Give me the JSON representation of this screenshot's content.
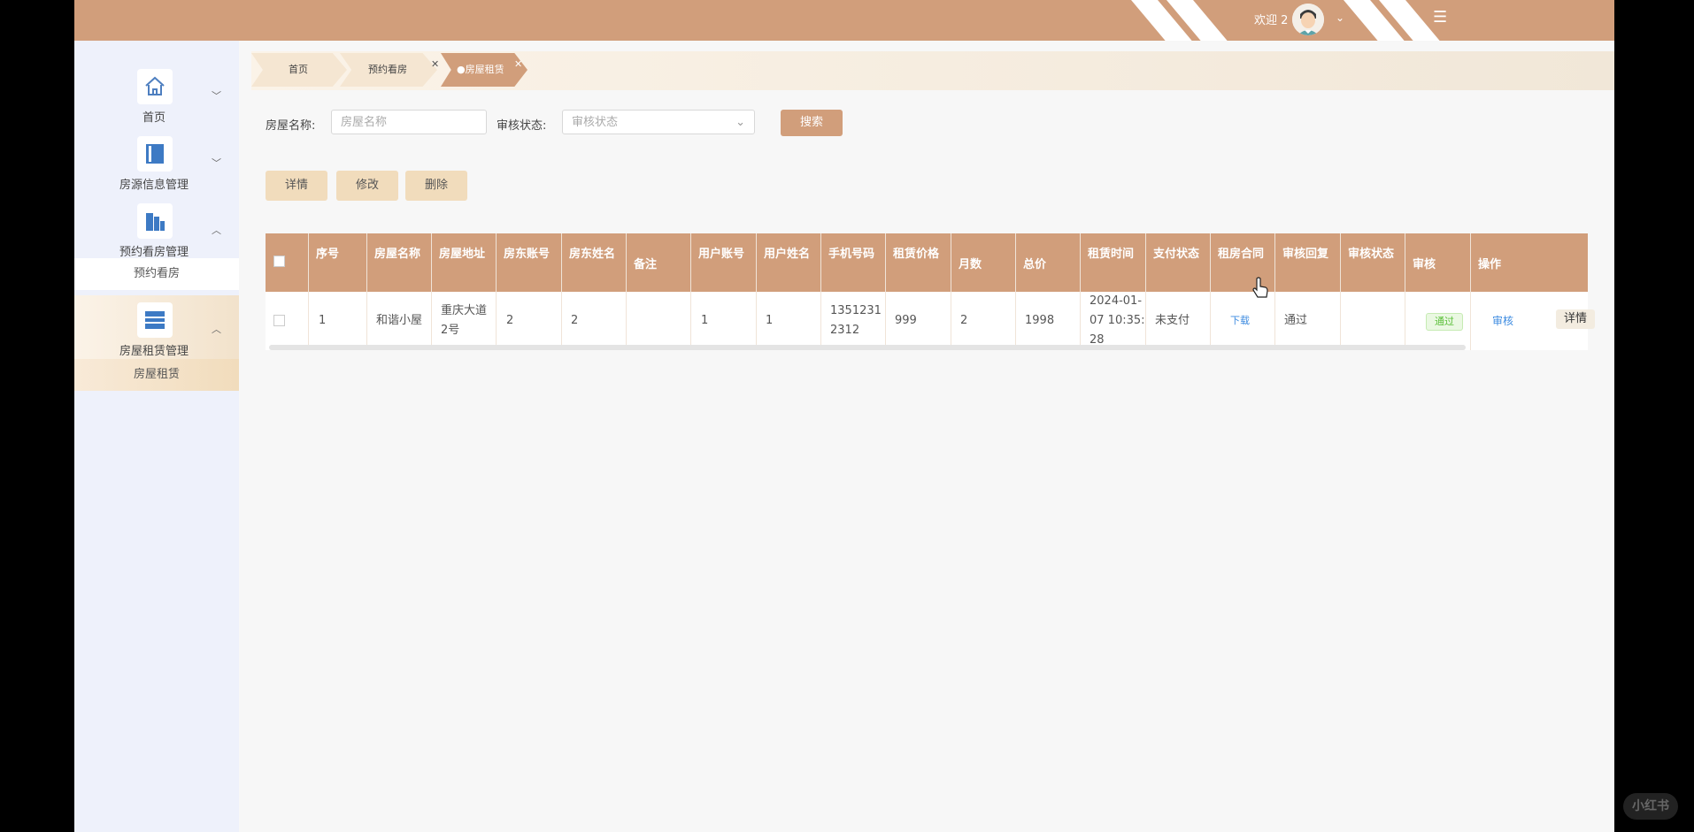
{
  "topbar": {
    "welcome": "欢迎 2",
    "colors": {
      "bar": "#d19e7b"
    }
  },
  "sidebar": {
    "items": [
      {
        "label": "首页",
        "icon": "home-icon"
      },
      {
        "label": "房源信息管理",
        "icon": "book-icon"
      },
      {
        "label": "预约看房管理",
        "icon": "building-icon"
      },
      {
        "label": "房屋租赁管理",
        "icon": "list-icon"
      }
    ],
    "subitems": [
      {
        "label": "预约看房"
      },
      {
        "label": "房屋租赁"
      }
    ]
  },
  "tabs": [
    {
      "label": "首页"
    },
    {
      "label": "预约看房"
    },
    {
      "label": "●房屋租赁"
    }
  ],
  "filter": {
    "house_name_label": "房屋名称:",
    "house_name_placeholder": "房屋名称",
    "status_label": "审核状态:",
    "status_placeholder": "审核状态",
    "search_button": "搜索"
  },
  "actions": {
    "detail": "详情",
    "edit": "修改",
    "delete": "删除"
  },
  "table": {
    "headers": [
      "序号",
      "房屋名称",
      "房屋地址",
      "房东账号",
      "房东姓名",
      "备注",
      "用户账号",
      "用户姓名",
      "手机号码",
      "租赁价格",
      "月数",
      "总价",
      "租赁时间",
      "支付状态",
      "租房合同",
      "审核回复",
      "审核状态",
      "审核",
      "操作"
    ],
    "row": {
      "index": "1",
      "house_name": "和谐小屋",
      "address_1": "重庆大道",
      "address_2": "2号",
      "landlord_account": "2",
      "landlord_name": "2",
      "remark": "",
      "user_account": "1",
      "user_name": "1",
      "phone_1": "1351231",
      "phone_2": "2312",
      "price": "999",
      "months": "2",
      "total": "1998",
      "time_1": "2024-01-",
      "time_2": "07 10:35:",
      "time_3": "28",
      "pay_status": "未支付",
      "contract": "下载",
      "reply": "通过",
      "audit_status": "通过",
      "audit": "审核",
      "operation": "详情"
    }
  },
  "watermark": "小红书"
}
